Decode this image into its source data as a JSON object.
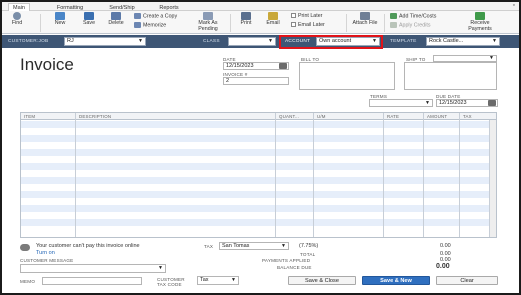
{
  "ribbon": {
    "tabs": [
      "Main",
      "Formatting",
      "Send/Ship",
      "Reports"
    ],
    "active_tab": "Main"
  },
  "toolbar": {
    "find": "Find",
    "new": "New",
    "save": "Save",
    "delete": "Delete",
    "create_copy": "Create a Copy",
    "memorize": "Memorize",
    "mark_as_pending": "Mark As Pending",
    "print": "Print",
    "email": "Email",
    "print_later": "Print Later",
    "email_later": "Email Later",
    "attach_file": "Attach File",
    "add_time_costs": "Add Time/Costs",
    "apply_credits": "Apply Credits",
    "receive_payments": "Receive Payments"
  },
  "customer_bar": {
    "customer_job_label": "CUSTOMER:JOB",
    "customer_job_value": "RJ",
    "class_label": "CLASS",
    "class_value": "",
    "account_label": "ACCOUNT",
    "account_value": "Own account",
    "template_label": "TEMPLATE",
    "template_value": "Rock Castle..."
  },
  "form": {
    "title": "Invoice",
    "date_label": "DATE",
    "date_value": "12/15/2023",
    "invoice_no_label": "INVOICE #",
    "invoice_no_value": "2",
    "bill_to_label": "BILL TO",
    "ship_to_label": "SHIP TO",
    "terms_label": "TERMS",
    "due_date_label": "DUE DATE",
    "due_date_value": "12/15/2023"
  },
  "table": {
    "columns": [
      "ITEM",
      "DESCRIPTION",
      "QUANT...",
      "U/M",
      "RATE",
      "AMOUNT",
      "TAX"
    ]
  },
  "footer": {
    "online_pay_text": "Your customer can't pay this invoice online",
    "turn_on": "Turn on",
    "customer_message_label": "CUSTOMER MESSAGE",
    "memo_label": "MEMO",
    "customer_tax_code_label": "CUSTOMER TAX CODE",
    "tax_code_value": "Tax",
    "tax_label": "TAX",
    "tax_item_value": "San Tomas",
    "tax_rate": "(7.75%)",
    "tax_amount": "0.00",
    "total_label": "TOTAL",
    "total_value": "0.00",
    "payments_applied_label": "PAYMENTS APPLIED",
    "payments_applied_value": "0.00",
    "balance_due_label": "BALANCE DUE",
    "balance_due_value": "0.00",
    "save_close": "Save & Close",
    "save_new": "Save & New",
    "clear": "Clear"
  },
  "colors": {
    "customer_bar_bg": "#3e5675",
    "highlight": "#e0131a",
    "row_alt": "#e6eefa",
    "primary_button": "#2f6fbf"
  }
}
